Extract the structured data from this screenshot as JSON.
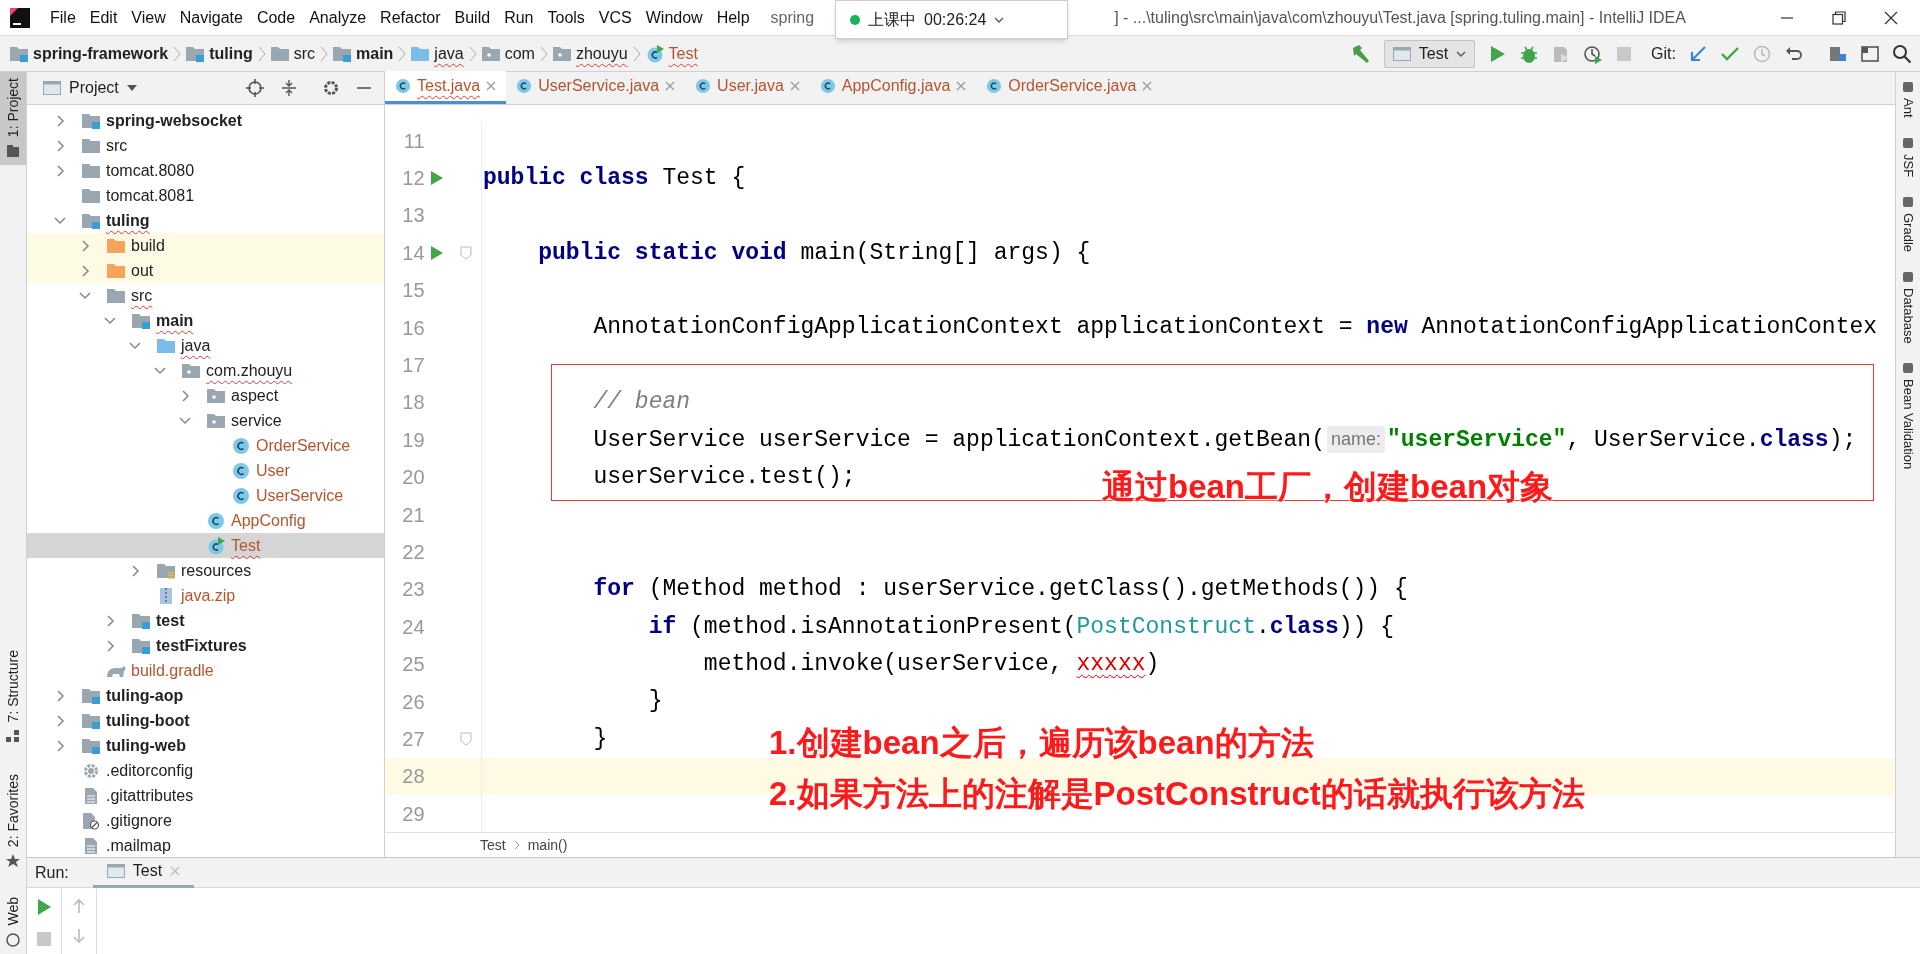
{
  "title_bar": {
    "menu": [
      "File",
      "Edit",
      "View",
      "Navigate",
      "Code",
      "Analyze",
      "Refactor",
      "Build",
      "Run",
      "Tools",
      "VCS",
      "Window",
      "Help"
    ],
    "title_left": "spring",
    "title_right": "] - ...\\tuling\\src\\main\\java\\com\\zhouyu\\Test.java [spring.tuling.main] - IntelliJ IDEA"
  },
  "recording_widget": {
    "status": "上课中",
    "time": "00:26:24"
  },
  "nav_bar": {
    "crumbs": [
      {
        "label": "spring-framework",
        "kind": "module",
        "squiggle": false
      },
      {
        "label": "tuling",
        "kind": "module",
        "squiggle": false
      },
      {
        "label": "src",
        "kind": "folder",
        "squiggle": false
      },
      {
        "label": "main",
        "kind": "module",
        "squiggle": false
      },
      {
        "label": "java",
        "kind": "source",
        "squiggle": true
      },
      {
        "label": "com",
        "kind": "package",
        "squiggle": false
      },
      {
        "label": "zhouyu",
        "kind": "package",
        "squiggle": true
      },
      {
        "label": "Test",
        "kind": "run_class",
        "squiggle": true,
        "color": "#b4552d"
      }
    ],
    "run_config": "Test",
    "git_label": "Git:"
  },
  "left_strip": [
    {
      "label": "1: Project",
      "selected": true
    },
    {
      "label": "7: Structure",
      "selected": false
    },
    {
      "label": "2: Favorites",
      "selected": false
    },
    {
      "label": "Web",
      "selected": false
    }
  ],
  "project_panel": {
    "title": "Project",
    "tree": [
      {
        "label": "spring-websocket",
        "kind": "module",
        "expanded": false,
        "selected": false,
        "squiggle": false
      },
      {
        "label": "src",
        "kind": "folder",
        "expanded": false,
        "selected": false,
        "squiggle": false
      },
      {
        "label": "tomcat.8080",
        "kind": "folder",
        "expanded": false,
        "selected": false,
        "squiggle": false
      },
      {
        "label": "tomcat.8081",
        "kind": "folder",
        "selected": false,
        "squiggle": false
      },
      {
        "label": "tuling",
        "kind": "module",
        "expanded": true,
        "selected": false,
        "squiggle": true,
        "children": [
          {
            "label": "build",
            "kind": "excluded",
            "expanded": false,
            "selected": false,
            "squiggle": false
          },
          {
            "label": "out",
            "kind": "excluded",
            "expanded": false,
            "selected": false,
            "squiggle": false
          },
          {
            "label": "src",
            "kind": "folder",
            "expanded": true,
            "selected": false,
            "squiggle": true,
            "children": [
              {
                "label": "main",
                "kind": "module",
                "expanded": true,
                "selected": false,
                "squiggle": true,
                "children": [
                  {
                    "label": "java",
                    "kind": "source",
                    "expanded": true,
                    "selected": false,
                    "squiggle": true,
                    "children": [
                      {
                        "label": "com.zhouyu",
                        "kind": "package",
                        "expanded": true,
                        "selected": false,
                        "squiggle": true,
                        "children": [
                          {
                            "label": "aspect",
                            "kind": "package",
                            "expanded": false,
                            "selected": false,
                            "squiggle": false
                          },
                          {
                            "label": "service",
                            "kind": "package",
                            "expanded": true,
                            "selected": false,
                            "squiggle": false,
                            "children": [
                              {
                                "label": "OrderService",
                                "kind": "class",
                                "selected": false,
                                "squiggle": false,
                                "color": "#b4552d"
                              },
                              {
                                "label": "User",
                                "kind": "class",
                                "selected": false,
                                "squiggle": false,
                                "color": "#b4552d"
                              },
                              {
                                "label": "UserService",
                                "kind": "class",
                                "selected": false,
                                "squiggle": false,
                                "color": "#b4552d"
                              }
                            ]
                          },
                          {
                            "label": "AppConfig",
                            "kind": "class",
                            "selected": false,
                            "squiggle": false,
                            "color": "#b4552d"
                          },
                          {
                            "label": "Test",
                            "kind": "run_class",
                            "selected": true,
                            "squiggle": true,
                            "color": "#b4552d"
                          }
                        ]
                      }
                    ]
                  },
                  {
                    "label": "resources",
                    "kind": "resources",
                    "expanded": false,
                    "selected": false,
                    "squiggle": false
                  },
                  {
                    "label": "java.zip",
                    "kind": "zip",
                    "selected": false,
                    "squiggle": false,
                    "color": "#b4552d"
                  }
                ]
              },
              {
                "label": "test",
                "kind": "module",
                "expanded": false,
                "selected": false,
                "squiggle": false
              },
              {
                "label": "testFixtures",
                "kind": "module",
                "expanded": false,
                "selected": false,
                "squiggle": false
              }
            ]
          },
          {
            "label": "build.gradle",
            "kind": "gradle",
            "selected": false,
            "squiggle": false,
            "color": "#b4552d"
          }
        ]
      },
      {
        "label": "tuling-aop",
        "kind": "module",
        "expanded": false,
        "selected": false,
        "squiggle": false
      },
      {
        "label": "tuling-boot",
        "kind": "module",
        "expanded": false,
        "selected": false,
        "squiggle": false
      },
      {
        "label": "tuling-web",
        "kind": "module",
        "expanded": false,
        "selected": false,
        "squiggle": false
      },
      {
        "label": ".editorconfig",
        "kind": "config",
        "selected": false,
        "squiggle": false
      },
      {
        "label": ".gitattributes",
        "kind": "text",
        "selected": false,
        "squiggle": false
      },
      {
        "label": ".gitignore",
        "kind": "ignore",
        "selected": false,
        "squiggle": false
      },
      {
        "label": ".mailmap",
        "kind": "text",
        "selected": false,
        "squiggle": false
      }
    ]
  },
  "editor": {
    "tabs": [
      {
        "label": "Test.java",
        "selected": true,
        "squiggle": true
      },
      {
        "label": "UserService.java",
        "selected": false,
        "squiggle": false
      },
      {
        "label": "User.java",
        "selected": false,
        "squiggle": false
      },
      {
        "label": "AppConfig.java",
        "selected": false,
        "squiggle": false
      },
      {
        "label": "OrderService.java",
        "selected": false,
        "squiggle": false
      }
    ],
    "lines": [
      {
        "number": "11",
        "run": false,
        "fold": false,
        "current": false
      },
      {
        "number": "12",
        "segments": [
          {
            "text": "public class ",
            "kind": "kw"
          },
          {
            "text": "Test {",
            "kind": "plain"
          }
        ],
        "run": true,
        "fold": false,
        "current": false
      },
      {
        "number": "13",
        "run": false,
        "fold": false,
        "current": false
      },
      {
        "number": "14",
        "segments": [
          {
            "text": "    public static void ",
            "kind": "kw"
          },
          {
            "text": "main(String[] args) {",
            "kind": "plain"
          }
        ],
        "run": true,
        "fold": true,
        "current": false
      },
      {
        "number": "15",
        "run": false,
        "fold": false,
        "current": false
      },
      {
        "number": "16",
        "segments": [
          {
            "text": "        AnnotationConfigApplicationContext applicationContext = ",
            "kind": "plain"
          },
          {
            "text": "new ",
            "kind": "kw"
          },
          {
            "text": "AnnotationConfigApplicationContex",
            "kind": "plain"
          }
        ],
        "run": false,
        "fold": false,
        "current": false
      },
      {
        "number": "17",
        "run": false,
        "fold": false,
        "current": false
      },
      {
        "number": "18",
        "segments": [
          {
            "text": "        // bean",
            "kind": "comment"
          }
        ],
        "run": false,
        "fold": false,
        "current": false
      },
      {
        "number": "19",
        "segments": [
          {
            "text": "        UserService userService = applicationContext.getBean(",
            "kind": "plain"
          },
          {
            "text": "name:",
            "kind": "hint"
          },
          {
            "text": "\"userService\"",
            "kind": "str"
          },
          {
            "text": ", UserService.",
            "kind": "plain"
          },
          {
            "text": "class",
            "kind": "kw"
          },
          {
            "text": ");",
            "kind": "plain"
          }
        ],
        "run": false,
        "fold": false,
        "current": false
      },
      {
        "number": "20",
        "segments": [
          {
            "text": "        userService.test();",
            "kind": "plain"
          }
        ],
        "run": false,
        "fold": false,
        "current": false
      },
      {
        "number": "21",
        "run": false,
        "fold": false,
        "current": false
      },
      {
        "number": "22",
        "run": false,
        "fold": false,
        "current": false
      },
      {
        "number": "23",
        "segments": [
          {
            "text": "        for ",
            "kind": "kw"
          },
          {
            "text": "(Method method : userService.getClass().getMethods()) {",
            "kind": "plain"
          }
        ],
        "run": false,
        "fold": false,
        "current": false
      },
      {
        "number": "24",
        "segments": [
          {
            "text": "            if ",
            "kind": "kw"
          },
          {
            "text": "(method.isAnnotationPresent(",
            "kind": "plain"
          },
          {
            "text": "PostConstruct",
            "kind": "cls"
          },
          {
            "text": ".",
            "kind": "plain"
          },
          {
            "text": "class",
            "kind": "kw"
          },
          {
            "text": ")) {",
            "kind": "plain"
          }
        ],
        "run": false,
        "fold": false,
        "current": false
      },
      {
        "number": "25",
        "segments": [
          {
            "text": "                method.invoke(userService, ",
            "kind": "plain"
          },
          {
            "text": "xxxxx",
            "kind": "err"
          },
          {
            "text": ")",
            "kind": "plain"
          }
        ],
        "run": false,
        "fold": false,
        "current": false
      },
      {
        "number": "26",
        "segments": [
          {
            "text": "            }",
            "kind": "plain"
          }
        ],
        "run": false,
        "fold": false,
        "current": false
      },
      {
        "number": "27",
        "segments": [
          {
            "text": "        }",
            "kind": "plain"
          }
        ],
        "run": false,
        "fold": true,
        "current": false
      },
      {
        "number": "28",
        "run": false,
        "fold": false,
        "current": true
      },
      {
        "number": "29",
        "run": false,
        "fold": false,
        "current": false
      }
    ],
    "breadcrumbs": [
      "Test",
      "main()"
    ]
  },
  "right_strip": [
    "Ant",
    "JSF",
    "Gradle",
    "Database",
    "Bean Validation"
  ],
  "run_panel": {
    "label": "Run:",
    "tab": "Test"
  },
  "annotations": {
    "box_note": "通过bean工厂，创建bean对象",
    "notes": [
      "1.创建bean之后，遍历该bean的方法",
      "2.如果方法上的注解是PostConstruct的话就执行该方法"
    ]
  }
}
